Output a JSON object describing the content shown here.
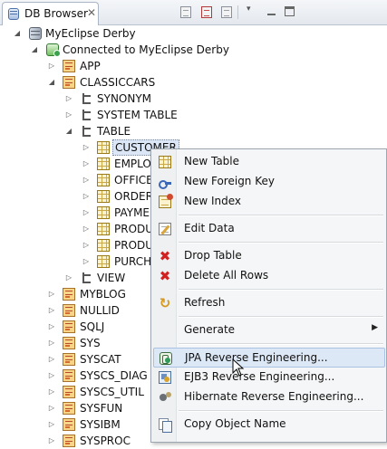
{
  "view": {
    "tab_label": "DB Browser",
    "close_glyph": "✕"
  },
  "tree": {
    "root": "MyEclipse Derby",
    "connection": "Connected to MyEclipse Derby",
    "schemas_before": [
      "APP",
      "CLASSICCARS"
    ],
    "classiccars_children": [
      "SYNONYM",
      "SYSTEM TABLE",
      "TABLE"
    ],
    "tables": [
      "CUSTOMER",
      "EMPLOY",
      "OFFICE",
      "ORDERD",
      "PAYMEN",
      "PRODUC",
      "PRODUC",
      "PURCHA"
    ],
    "view_folder": "VIEW",
    "schemas_after": [
      "MYBLOG",
      "NULLID",
      "SQLJ",
      "SYS",
      "SYSCAT",
      "SYSCS_DIAG",
      "SYSCS_UTIL",
      "SYSFUN",
      "SYSIBM",
      "SYSPROC"
    ]
  },
  "context_menu": {
    "items": [
      {
        "label": "New Table",
        "icon": "table-icon"
      },
      {
        "label": "New Foreign Key",
        "icon": "foreign-key-icon"
      },
      {
        "label": "New Index",
        "icon": "index-icon"
      },
      {
        "label": "Edit Data",
        "icon": "edit-data-icon"
      },
      {
        "label": "Drop Table",
        "icon": "delete-icon"
      },
      {
        "label": "Delete All Rows",
        "icon": "delete-icon"
      },
      {
        "label": "Refresh",
        "icon": "refresh-icon"
      },
      {
        "label": "Generate",
        "icon": "",
        "submenu": true
      },
      {
        "label": "JPA Reverse Engineering...",
        "icon": "jpa-icon",
        "hovered": true
      },
      {
        "label": "EJB3 Reverse Engineering...",
        "icon": "ejb3-icon"
      },
      {
        "label": "Hibernate Reverse Engineering...",
        "icon": "hibernate-icon"
      },
      {
        "label": "Copy Object Name",
        "icon": "copy-icon"
      }
    ],
    "submenu_arrow": "▶"
  },
  "glyphs": {
    "expanded": "◢",
    "collapsed": "▷",
    "x_mark": "✖",
    "refresh": "↻",
    "dropdown": "▾"
  }
}
